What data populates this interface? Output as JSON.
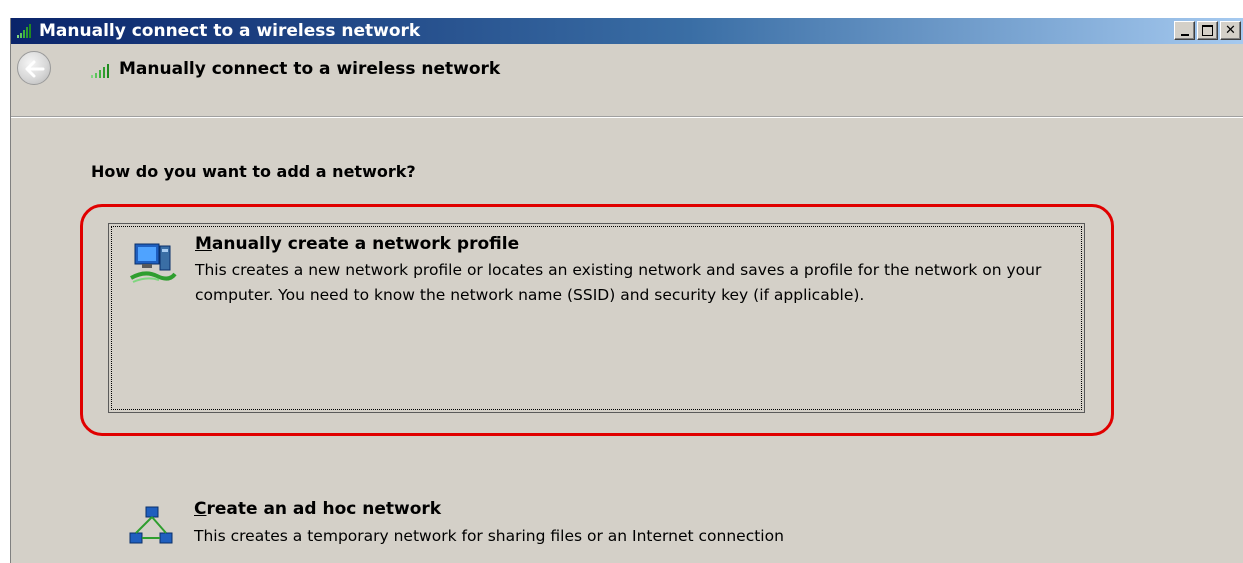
{
  "window": {
    "title": "Manually connect to a wireless network",
    "title_icon": "wireless-signal-icon",
    "controls": {
      "minimize": "minimize-icon",
      "maximize": "maximize-icon",
      "close": "close-icon",
      "close_glyph": "✕"
    }
  },
  "nav": {
    "back_icon": "back-arrow-icon",
    "header_icon": "wireless-signal-icon",
    "title": "Manually connect to a wireless network"
  },
  "content": {
    "prompt": "How do you want to add a network?",
    "options": [
      {
        "accelerator": "M",
        "title_rest": "anually create a network profile",
        "description": "This creates a new network profile or locates an existing network and saves a profile for the network on your computer. You need to know the network name (SSID) and security key (if applicable).",
        "icon": "network-profile-icon",
        "highlighted": true
      },
      {
        "accelerator": "C",
        "title_rest": "reate an ad hoc network",
        "description": "This creates a temporary network for sharing files or an Internet connection",
        "icon": "ad-hoc-network-icon",
        "highlighted": false
      }
    ]
  },
  "colors": {
    "titlebar_start": "#0a246a",
    "titlebar_end": "#a6caf0",
    "window_bg": "#d4d0c8",
    "highlight_ring": "#e00000",
    "signal_green": "#2f9e2f"
  }
}
